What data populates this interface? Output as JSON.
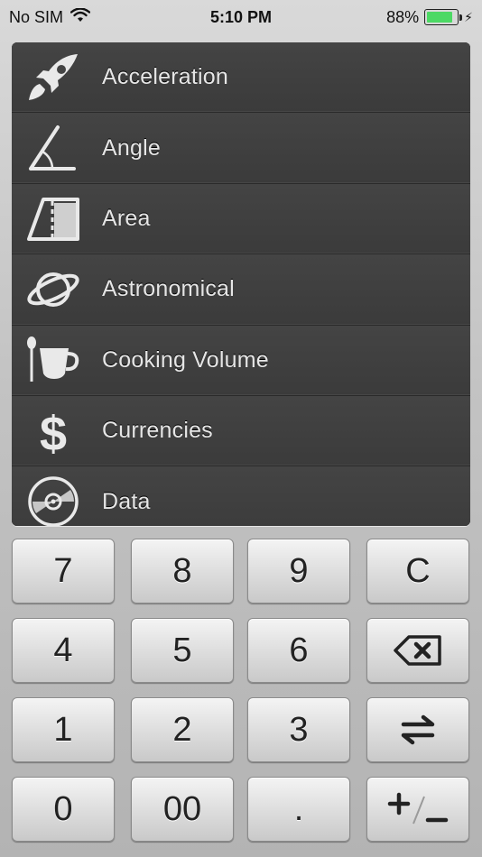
{
  "status_bar": {
    "carrier": "No SIM",
    "time": "5:10 PM",
    "battery_text": "88%",
    "battery_level": 0.88,
    "charging_icon": "bolt-icon",
    "wifi_icon": "wifi-icon"
  },
  "categories": [
    {
      "label": "Acceleration",
      "icon": "rocket-icon"
    },
    {
      "label": "Angle",
      "icon": "angle-icon"
    },
    {
      "label": "Area",
      "icon": "area-icon"
    },
    {
      "label": "Astronomical",
      "icon": "planet-icon"
    },
    {
      "label": "Cooking Volume",
      "icon": "cup-spoon-icon"
    },
    {
      "label": "Currencies",
      "icon": "dollar-icon"
    },
    {
      "label": "Data",
      "icon": "disc-icon"
    }
  ],
  "keypad": {
    "rows": [
      [
        "7",
        "8",
        "9",
        "C"
      ],
      [
        "4",
        "5",
        "6",
        "⌫"
      ],
      [
        "1",
        "2",
        "3",
        "⇄"
      ],
      [
        "0",
        "00",
        ".",
        "+/−"
      ]
    ]
  },
  "colors": {
    "battery_fill": "#4cd964",
    "list_background": "#3f3f3f",
    "list_text": "#e6e6e6"
  }
}
